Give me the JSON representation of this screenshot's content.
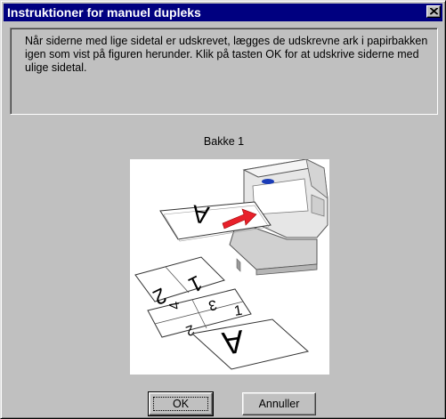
{
  "window": {
    "title": "Instruktioner for manuel dupleks"
  },
  "instructions": {
    "text": "Når siderne med lige sidetal er udskrevet, lægges de udskrevne ark i papirbakken igen som vist på figuren herunder. Klik på tasten OK for at udskrive siderne med ulige sidetal."
  },
  "figure": {
    "tray_label": "Bakke 1",
    "page_labels": [
      "A",
      "1",
      "2",
      "3",
      "4",
      "1",
      "2",
      "A"
    ]
  },
  "buttons": {
    "ok_label": "OK",
    "cancel_label": "Annuller"
  },
  "colors": {
    "titlebar": "#000080",
    "face": "#c0c0c0",
    "arrow": "#e8202a",
    "led": "#1a3cb8"
  },
  "icons": {
    "close": "close-icon",
    "insert_arrow": "arrow-icon"
  }
}
